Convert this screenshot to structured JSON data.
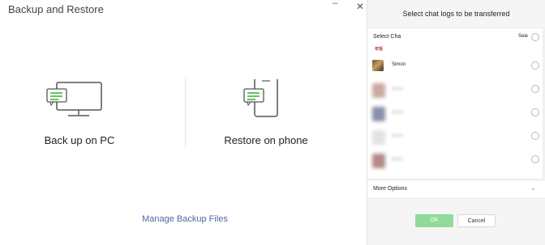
{
  "window": {
    "title": "Backup and Restore",
    "minimize_glyph": "–",
    "close_glyph": "✕"
  },
  "options": {
    "backup_pc": {
      "label": "Back up on PC",
      "icon": "monitor-chat-icon"
    },
    "restore_phone": {
      "label": "Restore on phone",
      "icon": "phone-chat-icon"
    }
  },
  "manage_link": "Manage Backup Files",
  "panel": {
    "title": "Select chat logs to be transferred",
    "list_header": "Select Cha",
    "select_all": "Sele",
    "red_tag": "年轻",
    "rows": [
      {
        "name": "Simon"
      },
      {
        "name": ""
      },
      {
        "name": ""
      },
      {
        "name": ""
      },
      {
        "name": ""
      }
    ],
    "more_options": "More Options",
    "ok_label": "OK",
    "cancel_label": "Cancel"
  },
  "colors": {
    "accent_green": "#3fb73f",
    "ok_button": "#8fdc9a",
    "link": "#4a6aa0"
  }
}
